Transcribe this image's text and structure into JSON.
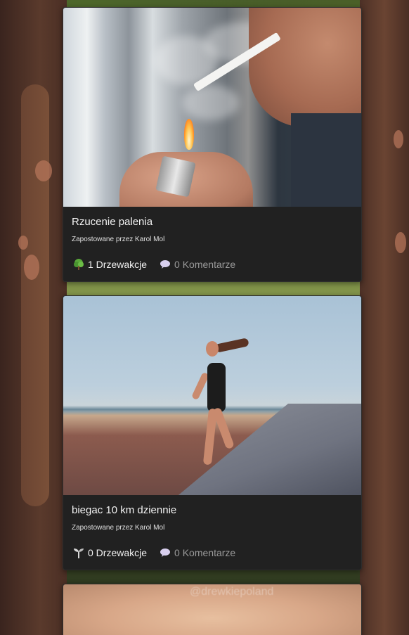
{
  "posts": [
    {
      "title": "Rzucenie palenia",
      "author": "Zapostowane przez Karol Mol",
      "trees_label": "1 Drzewakcje",
      "comments_label": "0 Komentarze",
      "tree_icon": "tree-icon"
    },
    {
      "title": "biegac 10 km dziennie",
      "author": "Zapostowane przez Karol Mol",
      "trees_label": "0 Drzewakcje",
      "comments_label": "0 Komentarze",
      "tree_icon": "sprout-icon"
    },
    {
      "watermark": "@drewkiepoland"
    }
  ],
  "colors": {
    "card_bg": "#212121",
    "title_text": "#f2f2f2",
    "comment_text": "#9a9a9a"
  }
}
